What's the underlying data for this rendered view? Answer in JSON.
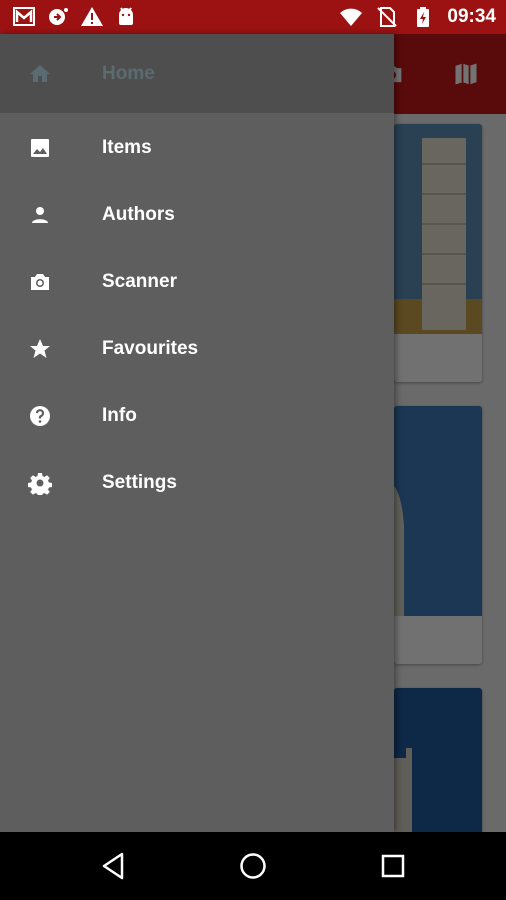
{
  "status_bar": {
    "time": "09:34",
    "left_icons": [
      "gmail-icon",
      "sync-icon",
      "warning-icon",
      "android-icon"
    ],
    "right_icons": [
      "wifi-icon",
      "no-sim-icon",
      "battery-charging-icon"
    ],
    "color": "#9c1212"
  },
  "toolbar": {
    "color": "#c51a1a",
    "actions": [
      "camera-icon",
      "map-icon"
    ]
  },
  "drawer": {
    "items": [
      {
        "label": "Home",
        "icon": "home-icon",
        "selected": true
      },
      {
        "label": "Items",
        "icon": "image-icon"
      },
      {
        "label": "Authors",
        "icon": "person-icon"
      },
      {
        "label": "Scanner",
        "icon": "camera-icon"
      },
      {
        "label": "Favourites",
        "icon": "star-icon"
      },
      {
        "label": "Info",
        "icon": "help-icon"
      },
      {
        "label": "Settings",
        "icon": "gear-icon"
      }
    ]
  },
  "nav_bar": {
    "buttons": [
      "back-icon",
      "home-circle-icon",
      "recents-icon"
    ]
  }
}
